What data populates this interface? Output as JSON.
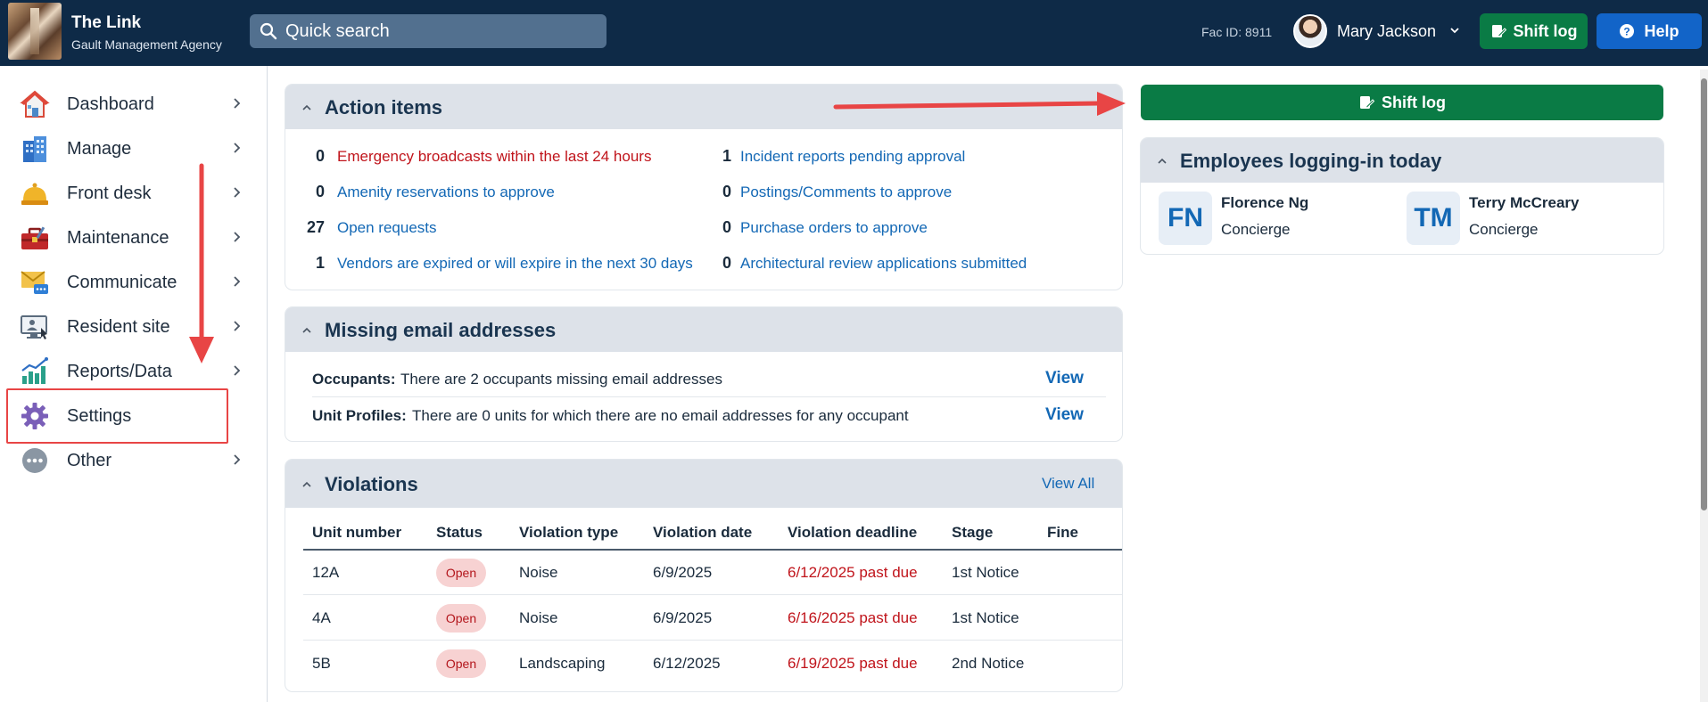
{
  "header": {
    "app_title": "The Link",
    "app_subtitle": "Gault Management Agency",
    "search_placeholder": "Quick search",
    "fac_id": "Fac ID: 8911",
    "user_name": "Mary Jackson",
    "shift_log_label": "Shift log",
    "help_label": "Help"
  },
  "sidebar": {
    "items": [
      {
        "label": "Dashboard",
        "icon": "house-icon"
      },
      {
        "label": "Manage",
        "icon": "building-icon"
      },
      {
        "label": "Front desk",
        "icon": "service-bell-icon"
      },
      {
        "label": "Maintenance",
        "icon": "toolbox-icon"
      },
      {
        "label": "Communicate",
        "icon": "envelope-chat-icon"
      },
      {
        "label": "Resident site",
        "icon": "monitor-user-icon"
      },
      {
        "label": "Reports/Data",
        "icon": "bar-chart-icon"
      },
      {
        "label": "Settings",
        "icon": "gear-icon"
      },
      {
        "label": "Other",
        "icon": "more-dots-icon"
      }
    ]
  },
  "action_items": {
    "title": "Action items",
    "left": [
      {
        "count": "0",
        "label": "Emergency broadcasts within the last 24 hours"
      },
      {
        "count": "0",
        "label": "Amenity reservations to approve"
      },
      {
        "count": "27",
        "label": "Open requests"
      },
      {
        "count": "1",
        "label": "Vendors are expired or will expire in the next 30 days"
      }
    ],
    "right": [
      {
        "count": "1",
        "label": "Incident reports pending approval"
      },
      {
        "count": "0",
        "label": "Postings/Comments to approve"
      },
      {
        "count": "0",
        "label": "Purchase orders to approve"
      },
      {
        "count": "0",
        "label": "Architectural review applications submitted"
      }
    ]
  },
  "missing_email": {
    "title": "Missing email addresses",
    "rows": [
      {
        "label": "Occupants:",
        "text": "There are 2 occupants missing email addresses",
        "action": "View"
      },
      {
        "label": "Unit Profiles:",
        "text": "There are 0 units for which there are no email addresses for any occupant",
        "action": "View"
      }
    ]
  },
  "violations": {
    "title": "Violations",
    "view_all": "View All",
    "columns": [
      "Unit number",
      "Status",
      "Violation type",
      "Violation date",
      "Violation deadline",
      "Stage",
      "Fine"
    ],
    "rows": [
      {
        "unit": "12A",
        "status": "Open",
        "type": "Noise",
        "date": "6/9/2025",
        "deadline": "6/12/2025 past due",
        "stage": "1st Notice",
        "fine": ""
      },
      {
        "unit": "4A",
        "status": "Open",
        "type": "Noise",
        "date": "6/9/2025",
        "deadline": "6/16/2025 past due",
        "stage": "1st Notice",
        "fine": ""
      },
      {
        "unit": "5B",
        "status": "Open",
        "type": "Landscaping",
        "date": "6/12/2025",
        "deadline": "6/19/2025 past due",
        "stage": "2nd Notice",
        "fine": ""
      }
    ]
  },
  "right_panel": {
    "shift_log_label": "Shift log",
    "employees_title": "Employees logging-in today",
    "employees": [
      {
        "initials": "FN",
        "name": "Florence Ng",
        "role": "Concierge"
      },
      {
        "initials": "TM",
        "name": "Terry McCreary",
        "role": "Concierge"
      }
    ]
  },
  "colors": {
    "header_bg": "#0e2a47",
    "accent_green": "#0a7b45",
    "accent_blue": "#1264c8",
    "link_blue": "#1368b5",
    "alert_red": "#c0141b",
    "annotation_red": "#e84545"
  }
}
